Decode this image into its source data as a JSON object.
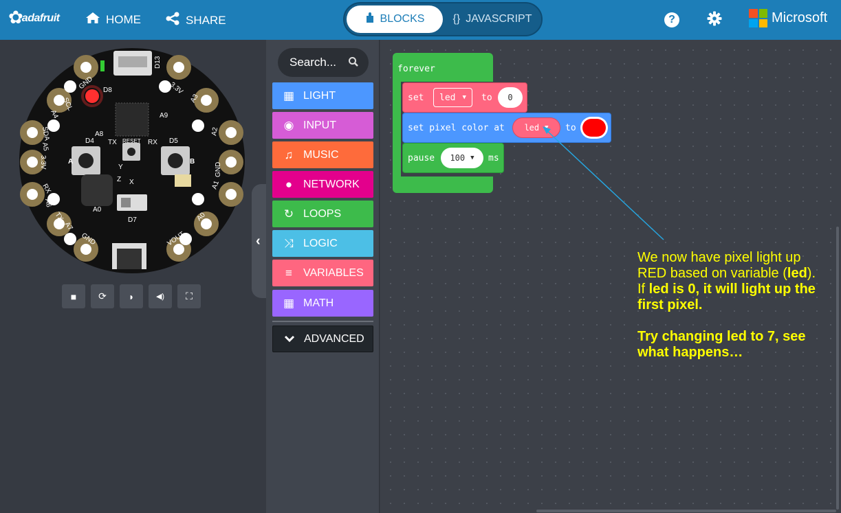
{
  "topbar": {
    "brand": "adafruit",
    "home_label": "HOME",
    "share_label": "SHARE",
    "blocks_label": "BLOCKS",
    "javascript_label": "JAVASCRIPT",
    "js_icon": "{}",
    "help_icon": "?",
    "microsoft_label": "Microsoft",
    "bar_color": "#1d7eb8"
  },
  "board": {
    "labels": {
      "gnd_top": "GND",
      "d8": "D8",
      "d13": "D13",
      "v33_top": "3.3V",
      "scl": "SCL",
      "a4": "A4",
      "a3": "A3",
      "a9": "A9",
      "a8": "A8",
      "sda": "SDA",
      "a5": "A5",
      "a2": "A2",
      "d4": "D4",
      "tx_top": "TX",
      "reset": "RESET",
      "rx_top": "RX",
      "d5": "D5",
      "v33_left": "3.3V",
      "gnd_right": "GND",
      "rx_left": "RX",
      "a6": "A6",
      "a1": "A1",
      "a0": "A0",
      "tx_left": "TX",
      "a7": "A7",
      "gnd_bottom": "GND",
      "vout": "VOUT",
      "d7": "D7",
      "a": "A",
      "b": "B",
      "x": "X",
      "y": "Y",
      "z": "Z"
    }
  },
  "sim_controls": [
    {
      "name": "stop-icon",
      "glyph": "■"
    },
    {
      "name": "restart-icon",
      "glyph": "⟳"
    },
    {
      "name": "slow-motion-icon",
      "glyph": "◗"
    },
    {
      "name": "sound-icon",
      "glyph": "◀)"
    },
    {
      "name": "fullscreen-icon",
      "glyph": "⛶"
    }
  ],
  "toolbox": {
    "search_placeholder": "Search...",
    "categories": [
      {
        "label": "LIGHT",
        "color": "#4c97ff",
        "icon": "▦"
      },
      {
        "label": "INPUT",
        "color": "#d65cd6",
        "icon": "◉"
      },
      {
        "label": "MUSIC",
        "color": "#fe6b3b",
        "icon": "♫"
      },
      {
        "label": "NETWORK",
        "color": "#e3008c",
        "icon": "●"
      },
      {
        "label": "LOOPS",
        "color": "#3dbb4b",
        "icon": "↻"
      },
      {
        "label": "LOGIC",
        "color": "#4cbfe6",
        "icon": "⤨"
      },
      {
        "label": "VARIABLES",
        "color": "#ff6680",
        "icon": "≡"
      },
      {
        "label": "MATH",
        "color": "#9966ff",
        "icon": "▦"
      }
    ],
    "advanced_label": "ADVANCED"
  },
  "workspace": {
    "forever_label": "forever",
    "set_label": "set",
    "var_name": "led",
    "to_label": "to",
    "set_value": "0",
    "pixel_label": "set pixel color at",
    "pixel_var": "led",
    "pixel_color": "#ff0000",
    "pause_label": "pause",
    "pause_value": "100",
    "ms_label": "ms"
  },
  "annotation": {
    "l1": "We now have pixel light up RED based on variable (",
    "l1_bold": "led",
    "l2": "). If ",
    "l2_bold": "led is 0, it will light up the first pixel.",
    "l3_bold": "Try changing led to 7, see what happens…",
    "color": "#ffff00"
  }
}
